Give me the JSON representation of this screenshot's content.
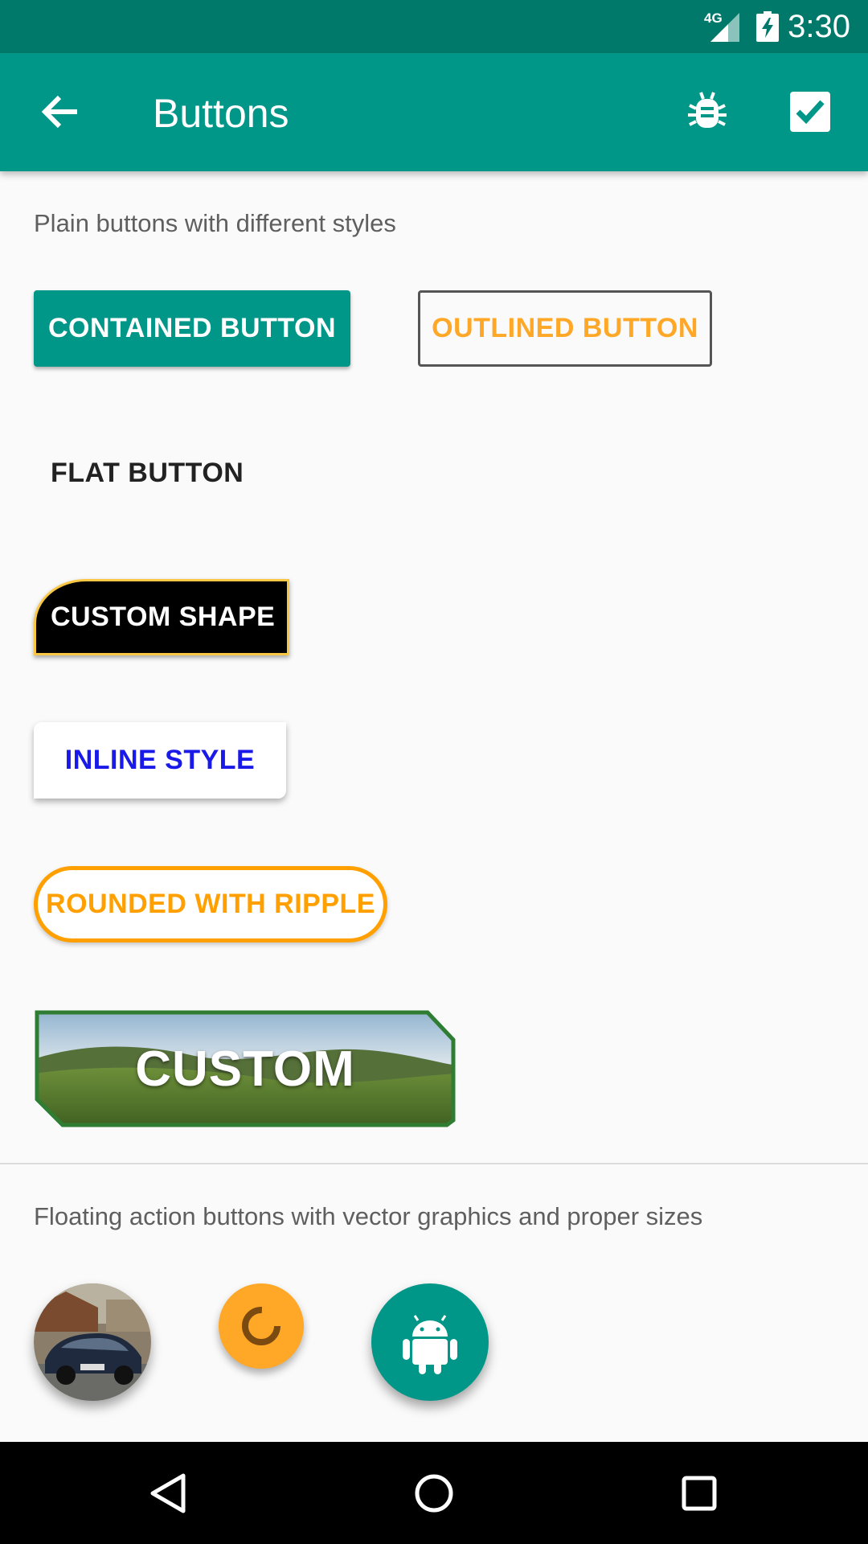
{
  "status_bar": {
    "network": "4G",
    "time": "3:30"
  },
  "app_bar": {
    "title": "Buttons",
    "icons": [
      "arrow-back-icon",
      "bug-icon",
      "check-box-icon"
    ]
  },
  "sections": {
    "plain_label": "Plain buttons with different styles",
    "fab_label": "Floating action buttons with vector graphics and proper sizes"
  },
  "buttons": {
    "contained": "CONTAINED BUTTON",
    "outlined": "OUTLINED BUTTON",
    "flat": "FLAT BUTTON",
    "custom_shape": "CUSTOM SHAPE",
    "inline_style": "INLINE STYLE",
    "rounded_ripple": "ROUNDED WITH RIPPLE",
    "custom": "CUSTOM"
  },
  "fabs": [
    {
      "name": "photo-fab",
      "icon": "car-photo"
    },
    {
      "name": "progress-fab",
      "icon": "progress-icon"
    },
    {
      "name": "android-fab",
      "icon": "android-icon"
    }
  ],
  "nav_bar": {
    "icons": [
      "back-triangle-icon",
      "home-circle-icon",
      "recents-square-icon"
    ]
  },
  "colors": {
    "primary": "#009688",
    "primary_dark": "#00796b",
    "accent": "#ffa726",
    "inline_text": "#1a1ae8",
    "custom_border": "#2e7d32"
  }
}
